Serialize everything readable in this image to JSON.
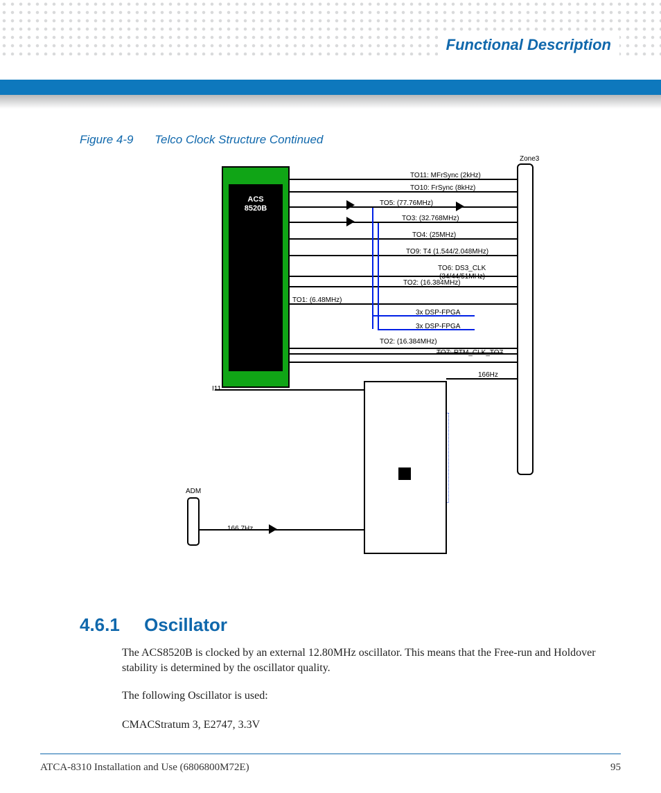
{
  "header": {
    "title": "Functional Description"
  },
  "figure": {
    "label": "Figure 4-9",
    "caption": "Telco Clock Structure Continued"
  },
  "diagram": {
    "chip_line1": "ACS",
    "chip_line2": "8520B",
    "zone3": "Zone3",
    "adm": "ADM",
    "i11": "I11",
    "freq_bottom": "166.7Hz",
    "freq_right": "166Hz",
    "signals": {
      "to11": "TO11: MFrSync (2kHz)",
      "to10": "TO10: FrSync (8kHz)",
      "to5": "TO5:  (77.76MHz)",
      "to3": "TO3: (32.768MHz)",
      "to4": "TO4: (25MHz)",
      "to9": "TO9: T4 (1.544/2.048MHz)",
      "to6a": "TO6: DS3_CLK",
      "to6b": "(34/44/51MHz)",
      "to2a": "TO2: (16.384MHz)",
      "to1": "TO1: (6.48MHz)",
      "dsp1": "3x DSP-FPGA",
      "dsp2": "3x DSP-FPGA",
      "to2b": "TO2: (16.384MHz)",
      "to7": "TO7: RTM_CLK_TO7"
    }
  },
  "section": {
    "number": "4.6.1",
    "title": "Oscillator",
    "p1": "The ACS8520B is clocked by an external 12.80MHz oscillator. This means that the Free-run and Holdover stability is determined by the oscillator quality.",
    "p2": "The following Oscillator is used:",
    "p3": "CMACStratum 3, E2747, 3.3V"
  },
  "footer": {
    "doc": "ATCA-8310 Installation and Use (6806800M72E)",
    "page": "95"
  }
}
